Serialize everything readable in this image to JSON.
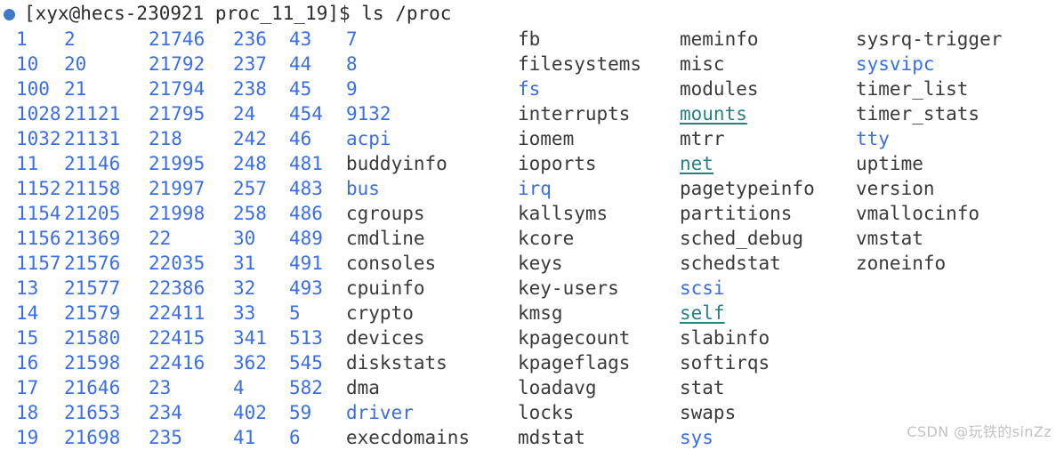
{
  "terminal": {
    "prompt": {
      "bullet_color": "#3d7bc8",
      "text": "[xyx@hecs-230921 proc_11_19]$ ls /proc"
    },
    "colors": {
      "background": "#ffffff",
      "directory": "#3a6ee8",
      "file": "#3a3a3a",
      "symlink": "#2a8080",
      "watermark": "#c2c2c2"
    },
    "watermark": "CSDN @玩铁的sinZz",
    "rows": [
      [
        {
          "t": "1",
          "k": "dir"
        },
        {
          "t": "2",
          "k": "dir"
        },
        {
          "t": "21746",
          "k": "dir"
        },
        {
          "t": "236",
          "k": "dir"
        },
        {
          "t": "43",
          "k": "dir"
        },
        {
          "t": "7",
          "k": "dir"
        },
        {
          "t": "fb",
          "k": "file"
        },
        {
          "t": "meminfo",
          "k": "file"
        },
        {
          "t": "sysrq-trigger",
          "k": "file"
        }
      ],
      [
        {
          "t": "10",
          "k": "dir"
        },
        {
          "t": "20",
          "k": "dir"
        },
        {
          "t": "21792",
          "k": "dir"
        },
        {
          "t": "237",
          "k": "dir"
        },
        {
          "t": "44",
          "k": "dir"
        },
        {
          "t": "8",
          "k": "dir"
        },
        {
          "t": "filesystems",
          "k": "file"
        },
        {
          "t": "misc",
          "k": "file"
        },
        {
          "t": "sysvipc",
          "k": "dir"
        }
      ],
      [
        {
          "t": "100",
          "k": "dir"
        },
        {
          "t": "21",
          "k": "dir"
        },
        {
          "t": "21794",
          "k": "dir"
        },
        {
          "t": "238",
          "k": "dir"
        },
        {
          "t": "45",
          "k": "dir"
        },
        {
          "t": "9",
          "k": "dir"
        },
        {
          "t": "fs",
          "k": "dir"
        },
        {
          "t": "modules",
          "k": "file"
        },
        {
          "t": "timer_list",
          "k": "file"
        }
      ],
      [
        {
          "t": "1028",
          "k": "dir"
        },
        {
          "t": "21121",
          "k": "dir"
        },
        {
          "t": "21795",
          "k": "dir"
        },
        {
          "t": "24",
          "k": "dir"
        },
        {
          "t": "454",
          "k": "dir"
        },
        {
          "t": "9132",
          "k": "dir"
        },
        {
          "t": "interrupts",
          "k": "file"
        },
        {
          "t": "mounts",
          "k": "link"
        },
        {
          "t": "timer_stats",
          "k": "file"
        }
      ],
      [
        {
          "t": "1032",
          "k": "dir"
        },
        {
          "t": "21131",
          "k": "dir"
        },
        {
          "t": "218",
          "k": "dir"
        },
        {
          "t": "242",
          "k": "dir"
        },
        {
          "t": "46",
          "k": "dir"
        },
        {
          "t": "acpi",
          "k": "dir"
        },
        {
          "t": "iomem",
          "k": "file"
        },
        {
          "t": "mtrr",
          "k": "file"
        },
        {
          "t": "tty",
          "k": "dir"
        }
      ],
      [
        {
          "t": "11",
          "k": "dir"
        },
        {
          "t": "21146",
          "k": "dir"
        },
        {
          "t": "21995",
          "k": "dir"
        },
        {
          "t": "248",
          "k": "dir"
        },
        {
          "t": "481",
          "k": "dir"
        },
        {
          "t": "buddyinfo",
          "k": "file"
        },
        {
          "t": "ioports",
          "k": "file"
        },
        {
          "t": "net",
          "k": "link"
        },
        {
          "t": "uptime",
          "k": "file"
        }
      ],
      [
        {
          "t": "1152",
          "k": "dir"
        },
        {
          "t": "21158",
          "k": "dir"
        },
        {
          "t": "21997",
          "k": "dir"
        },
        {
          "t": "257",
          "k": "dir"
        },
        {
          "t": "483",
          "k": "dir"
        },
        {
          "t": "bus",
          "k": "dir"
        },
        {
          "t": "irq",
          "k": "dir"
        },
        {
          "t": "pagetypeinfo",
          "k": "file"
        },
        {
          "t": "version",
          "k": "file"
        }
      ],
      [
        {
          "t": "1154",
          "k": "dir"
        },
        {
          "t": "21205",
          "k": "dir"
        },
        {
          "t": "21998",
          "k": "dir"
        },
        {
          "t": "258",
          "k": "dir"
        },
        {
          "t": "486",
          "k": "dir"
        },
        {
          "t": "cgroups",
          "k": "file"
        },
        {
          "t": "kallsyms",
          "k": "file"
        },
        {
          "t": "partitions",
          "k": "file"
        },
        {
          "t": "vmallocinfo",
          "k": "file"
        }
      ],
      [
        {
          "t": "1156",
          "k": "dir"
        },
        {
          "t": "21369",
          "k": "dir"
        },
        {
          "t": "22",
          "k": "dir"
        },
        {
          "t": "30",
          "k": "dir"
        },
        {
          "t": "489",
          "k": "dir"
        },
        {
          "t": "cmdline",
          "k": "file"
        },
        {
          "t": "kcore",
          "k": "file"
        },
        {
          "t": "sched_debug",
          "k": "file"
        },
        {
          "t": "vmstat",
          "k": "file"
        }
      ],
      [
        {
          "t": "1157",
          "k": "dir"
        },
        {
          "t": "21576",
          "k": "dir"
        },
        {
          "t": "22035",
          "k": "dir"
        },
        {
          "t": "31",
          "k": "dir"
        },
        {
          "t": "491",
          "k": "dir"
        },
        {
          "t": "consoles",
          "k": "file"
        },
        {
          "t": "keys",
          "k": "file"
        },
        {
          "t": "schedstat",
          "k": "file"
        },
        {
          "t": "zoneinfo",
          "k": "file"
        }
      ],
      [
        {
          "t": "13",
          "k": "dir"
        },
        {
          "t": "21577",
          "k": "dir"
        },
        {
          "t": "22386",
          "k": "dir"
        },
        {
          "t": "32",
          "k": "dir"
        },
        {
          "t": "493",
          "k": "dir"
        },
        {
          "t": "cpuinfo",
          "k": "file"
        },
        {
          "t": "key-users",
          "k": "file"
        },
        {
          "t": "scsi",
          "k": "dir"
        },
        {
          "t": "",
          "k": "file"
        }
      ],
      [
        {
          "t": "14",
          "k": "dir"
        },
        {
          "t": "21579",
          "k": "dir"
        },
        {
          "t": "22411",
          "k": "dir"
        },
        {
          "t": "33",
          "k": "dir"
        },
        {
          "t": "5",
          "k": "dir"
        },
        {
          "t": "crypto",
          "k": "file"
        },
        {
          "t": "kmsg",
          "k": "file"
        },
        {
          "t": "self",
          "k": "link"
        },
        {
          "t": "",
          "k": "file"
        }
      ],
      [
        {
          "t": "15",
          "k": "dir"
        },
        {
          "t": "21580",
          "k": "dir"
        },
        {
          "t": "22415",
          "k": "dir"
        },
        {
          "t": "341",
          "k": "dir"
        },
        {
          "t": "513",
          "k": "dir"
        },
        {
          "t": "devices",
          "k": "file"
        },
        {
          "t": "kpagecount",
          "k": "file"
        },
        {
          "t": "slabinfo",
          "k": "file"
        },
        {
          "t": "",
          "k": "file"
        }
      ],
      [
        {
          "t": "16",
          "k": "dir"
        },
        {
          "t": "21598",
          "k": "dir"
        },
        {
          "t": "22416",
          "k": "dir"
        },
        {
          "t": "362",
          "k": "dir"
        },
        {
          "t": "545",
          "k": "dir"
        },
        {
          "t": "diskstats",
          "k": "file"
        },
        {
          "t": "kpageflags",
          "k": "file"
        },
        {
          "t": "softirqs",
          "k": "file"
        },
        {
          "t": "",
          "k": "file"
        }
      ],
      [
        {
          "t": "17",
          "k": "dir"
        },
        {
          "t": "21646",
          "k": "dir"
        },
        {
          "t": "23",
          "k": "dir"
        },
        {
          "t": "4",
          "k": "dir"
        },
        {
          "t": "582",
          "k": "dir"
        },
        {
          "t": "dma",
          "k": "file"
        },
        {
          "t": "loadavg",
          "k": "file"
        },
        {
          "t": "stat",
          "k": "file"
        },
        {
          "t": "",
          "k": "file"
        }
      ],
      [
        {
          "t": "18",
          "k": "dir"
        },
        {
          "t": "21653",
          "k": "dir"
        },
        {
          "t": "234",
          "k": "dir"
        },
        {
          "t": "402",
          "k": "dir"
        },
        {
          "t": "59",
          "k": "dir"
        },
        {
          "t": "driver",
          "k": "dir"
        },
        {
          "t": "locks",
          "k": "file"
        },
        {
          "t": "swaps",
          "k": "file"
        },
        {
          "t": "",
          "k": "file"
        }
      ],
      [
        {
          "t": "19",
          "k": "dir"
        },
        {
          "t": "21698",
          "k": "dir"
        },
        {
          "t": "235",
          "k": "dir"
        },
        {
          "t": "41",
          "k": "dir"
        },
        {
          "t": "6",
          "k": "dir"
        },
        {
          "t": "execdomains",
          "k": "file"
        },
        {
          "t": "mdstat",
          "k": "file"
        },
        {
          "t": "sys",
          "k": "dir"
        },
        {
          "t": "",
          "k": "file"
        }
      ]
    ]
  }
}
